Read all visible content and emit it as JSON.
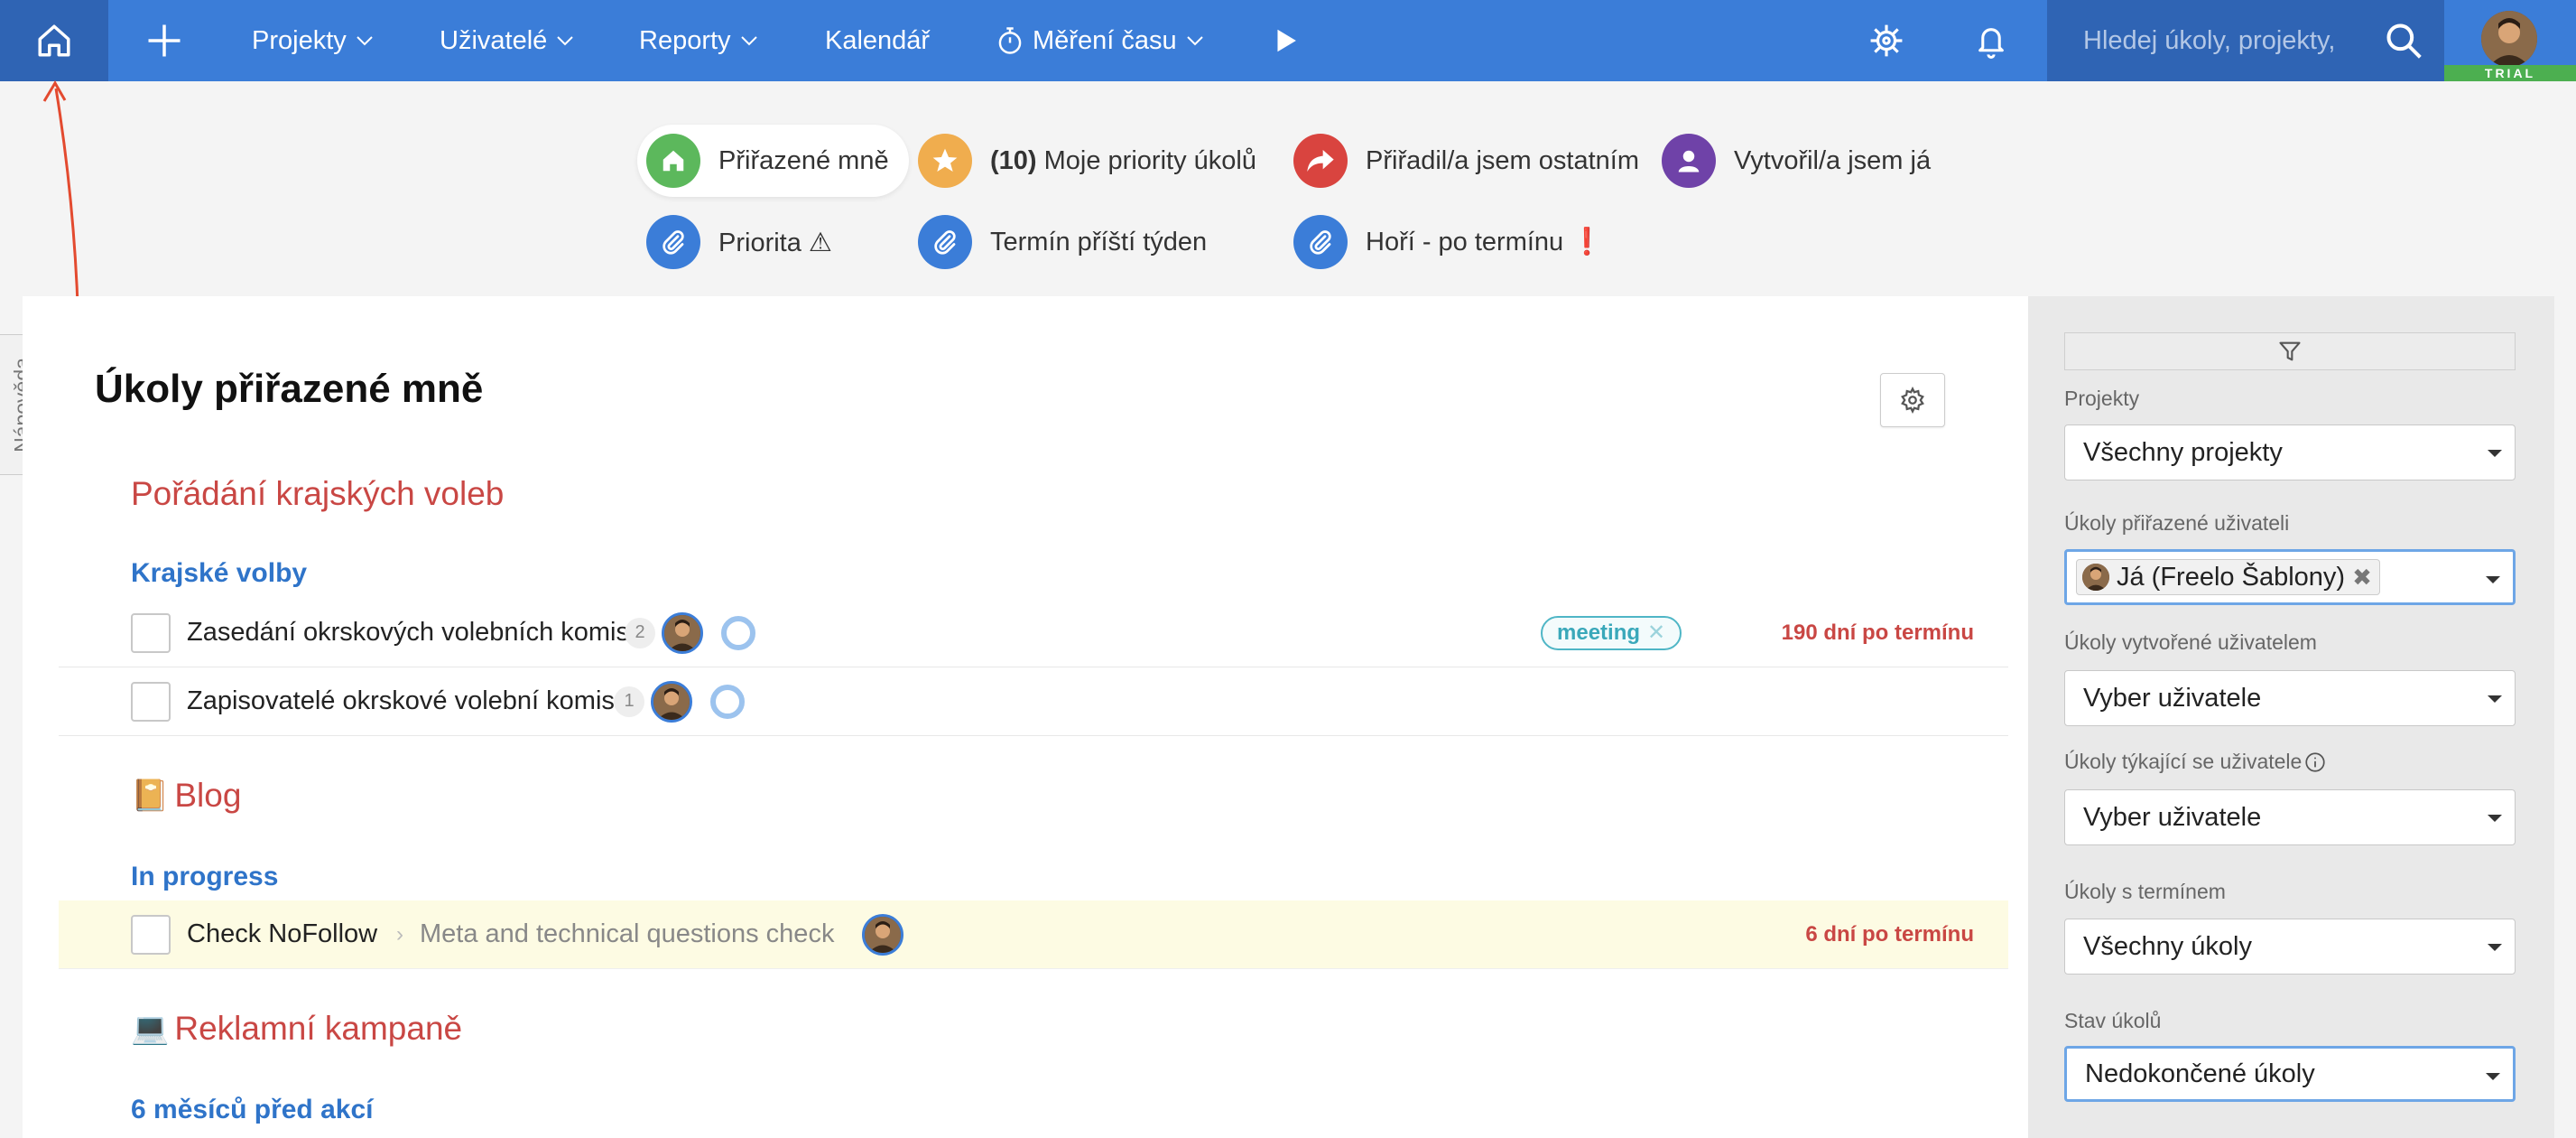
{
  "nav": {
    "menus": [
      {
        "id": "projects",
        "label": "Projekty"
      },
      {
        "id": "users",
        "label": "Uživatelé"
      },
      {
        "id": "reports",
        "label": "Reporty"
      },
      {
        "id": "calendar",
        "label": "Kalendář"
      },
      {
        "id": "timetracking",
        "label": "Měření času"
      }
    ],
    "search_placeholder": "Hledej úkoly, projekty,",
    "trial_badge": "TRIAL",
    "icons": [
      "home-icon",
      "plus-icon",
      "stopwatch-icon",
      "play-icon",
      "helm-icon",
      "bell-icon",
      "search-icon"
    ]
  },
  "quick_filters": [
    {
      "label": "Přiřazené mně",
      "icon": "home-icon",
      "color": "#5cb85c",
      "active": true
    },
    {
      "count": "(10)",
      "label": "Moje priority úkolů",
      "icon": "star-icon",
      "color": "#f0ad4e"
    },
    {
      "label": "Přiřadil/a jsem ostatním",
      "icon": "share-arrow-icon",
      "color": "#d9443f"
    },
    {
      "label": "Vytvořil/a jsem já",
      "icon": "user-icon",
      "color": "#6f42a8"
    },
    {
      "label": "Priorita ⚠",
      "icon": "paperclip-icon",
      "color": "#3b7dd8"
    },
    {
      "label": "Termín příští týden",
      "icon": "paperclip-icon",
      "color": "#3b7dd8"
    },
    {
      "label": "Hoří - po termínu",
      "mark": "❗",
      "icon": "paperclip-icon",
      "color": "#3b7dd8"
    }
  ],
  "help_tab": "Nápověda",
  "main": {
    "title": "Úkoly přiřazené mně",
    "projects": [
      {
        "name": "Pořádání krajských voleb",
        "emoji": "",
        "list": "Krajské volby",
        "tasks": [
          {
            "name": "Zasedání okrskových volebních komisí",
            "subtasks": "2",
            "tag": "meeting",
            "overdue": "190 dní po termínu"
          },
          {
            "name": "Zapisovatelé okrskové volební komise",
            "subtasks": "1"
          }
        ]
      },
      {
        "name": "Blog",
        "emoji": "📔",
        "list": "In progress",
        "tasks": [
          {
            "name": "Check NoFollow",
            "parent": "Meta and technical questions check",
            "overdue": "6 dní po termínu"
          }
        ]
      },
      {
        "name": "Reklamní kampaně",
        "emoji": "💻",
        "list": "6 měsíců před akcí",
        "tasks": []
      }
    ]
  },
  "filters": {
    "projects_label": "Projekty",
    "projects_value": "Všechny projekty",
    "assigned_label": "Úkoly přiřazené uživateli",
    "assigned_chip": "Já (Freelo Šablony)",
    "created_label": "Úkoly vytvořené uživatelem",
    "created_value": "Vyber uživatele",
    "concerning_label": "Úkoly týkající se uživatele",
    "concerning_value": "Vyber uživatele",
    "deadline_label": "Úkoly s termínem",
    "deadline_value": "Všechny úkoly",
    "state_label": "Stav úkolů",
    "state_value": "Nedokončené úkoly"
  }
}
